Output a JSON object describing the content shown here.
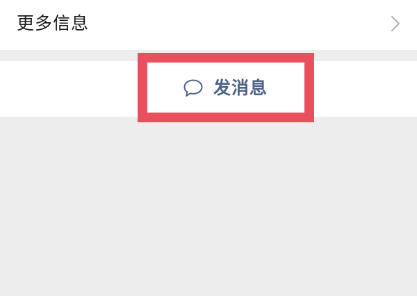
{
  "more_info": {
    "label": "更多信息",
    "chevron_icon": "chevron-right-icon"
  },
  "actions": {
    "send_message": {
      "label": "发消息",
      "icon": "chat-bubble-icon"
    }
  },
  "colors": {
    "background": "#ededed",
    "row_background": "#ffffff",
    "text_primary": "#1a1a1a",
    "action_text": "#4f6287",
    "highlight": "#e8505e",
    "chevron": "#b2b2b2"
  }
}
